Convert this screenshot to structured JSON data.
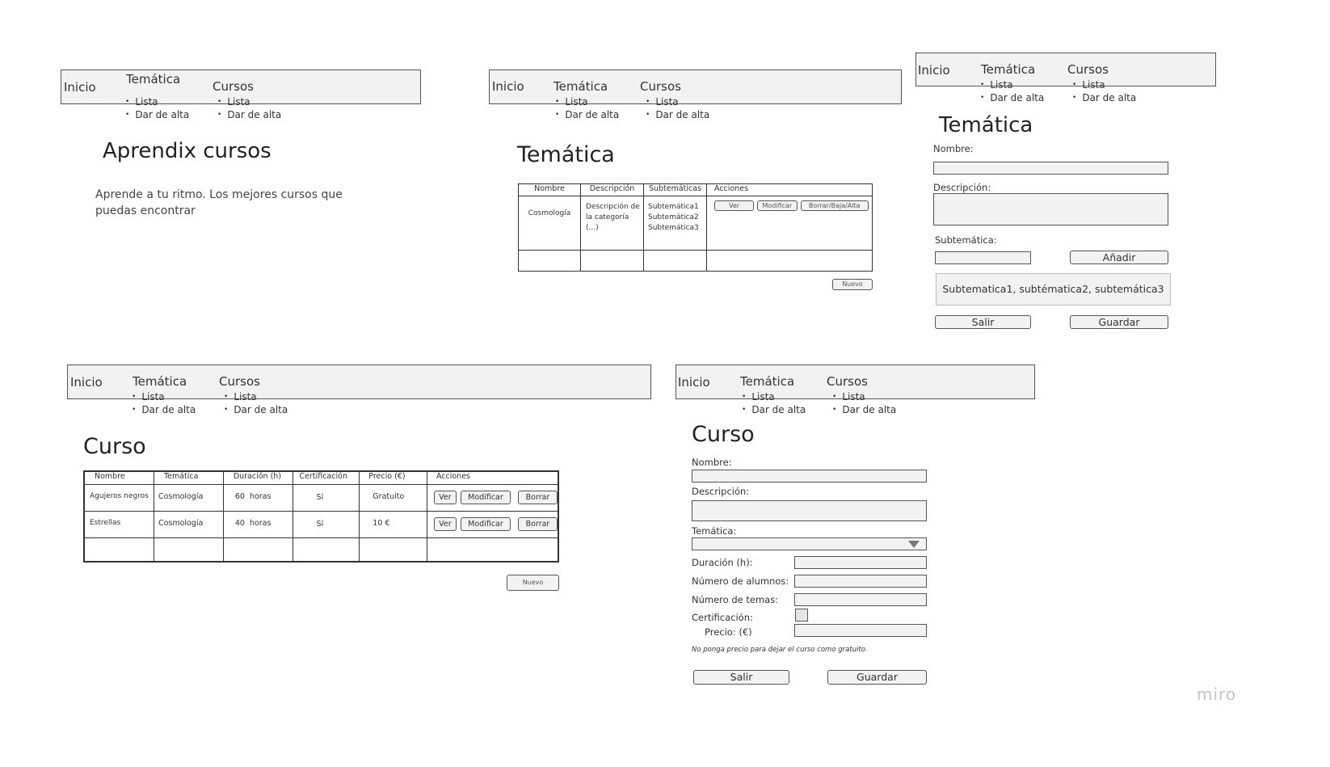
{
  "nav": {
    "inicio": "Inicio",
    "tematica": "Temática",
    "cursos": "Cursos",
    "lista": "Lista",
    "alta": "Dar de alta"
  },
  "home": {
    "title": "Aprendix cursos",
    "subtitle_line1": "Aprende a tu ritmo. Los mejores cursos que",
    "subtitle_line2": "puedas encontrar"
  },
  "tematica_list": {
    "title": "Temática",
    "headers": [
      "Nombre",
      "Descripción",
      "Subtemáticas",
      "Acciones"
    ],
    "row": {
      "nombre": "Cosmología",
      "desc1": "Descripción de",
      "desc2": "la categoría (...)",
      "subs": [
        "Subtemática1",
        "Subtemática2",
        "Subtemática3"
      ],
      "actions": [
        "Ver",
        "Modificar",
        "Borrar/Baja/Alta"
      ]
    },
    "new_button": "Nuevo"
  },
  "tematica_form": {
    "title": "Temática",
    "nombre_label": "Nombre:",
    "descripcion_label": "Descripción:",
    "subtematica_label": "Subtemática:",
    "add_button": "Añadir",
    "sub_list": "Subtematica1, subtématica2, subtemática3",
    "exit_button": "Salir",
    "save_button": "Guardar"
  },
  "curso_list": {
    "title": "Curso",
    "headers": [
      "Nombre",
      "Temática",
      "Duración (h)",
      "Certificación",
      "Precio (€)",
      "Acciones"
    ],
    "rows": [
      {
        "nombre": "Agujeros negros",
        "tematica": "Cosmología",
        "duracion": "60  horas",
        "cert": "Sí",
        "precio": "Gratuito"
      },
      {
        "nombre": "Estrellas",
        "tematica": "Cosmología",
        "duracion": "40  horas",
        "cert": "Sí",
        "precio": "10 €"
      }
    ],
    "actions": [
      "Ver",
      "Modificar",
      "Borrar"
    ],
    "new_button": "Nuevo"
  },
  "curso_form": {
    "title": "Curso",
    "nombre_label": "Nombre:",
    "descripcion_label": "Descripción:",
    "tematica_label": "Temática:",
    "duracion_label": "Duración (h):",
    "alumnos_label": "Número de alumnos:",
    "temas_label": "Número de temas:",
    "cert_label": "Certificación:",
    "precio_label": "Precio: (€)",
    "note": "No ponga precio para dejar el curso como gratuito.",
    "exit_button": "Salir",
    "save_button": "Guardar"
  },
  "brand": "miro"
}
